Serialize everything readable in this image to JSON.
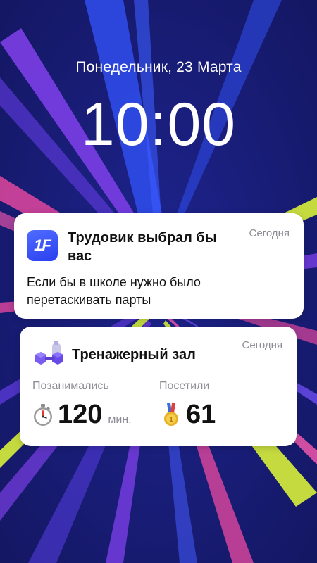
{
  "lockscreen": {
    "date": "Понедельник, 23 Марта",
    "time": "10:00"
  },
  "notifications": [
    {
      "app_icon": "1f-app-icon",
      "icon_text": "1F",
      "title": "Трудовик выбрал бы вас",
      "time": "Сегодня",
      "body": "Если бы в школе нужно было перетаскивать парты"
    },
    {
      "app_icon": "dumbbell-icon",
      "title": "Тренажерный зал",
      "time": "Сегодня",
      "stats": [
        {
          "label": "Позанимались",
          "icon": "stopwatch-icon",
          "value": "120",
          "unit": "мин."
        },
        {
          "label": "Посетили",
          "icon": "medal-icon",
          "value": "61",
          "unit": ""
        }
      ]
    }
  ],
  "colors": {
    "background": "#1b1f78",
    "card": "#ffffff",
    "accent_blue": "#2b3ff0",
    "muted_text": "#8c8c94"
  }
}
